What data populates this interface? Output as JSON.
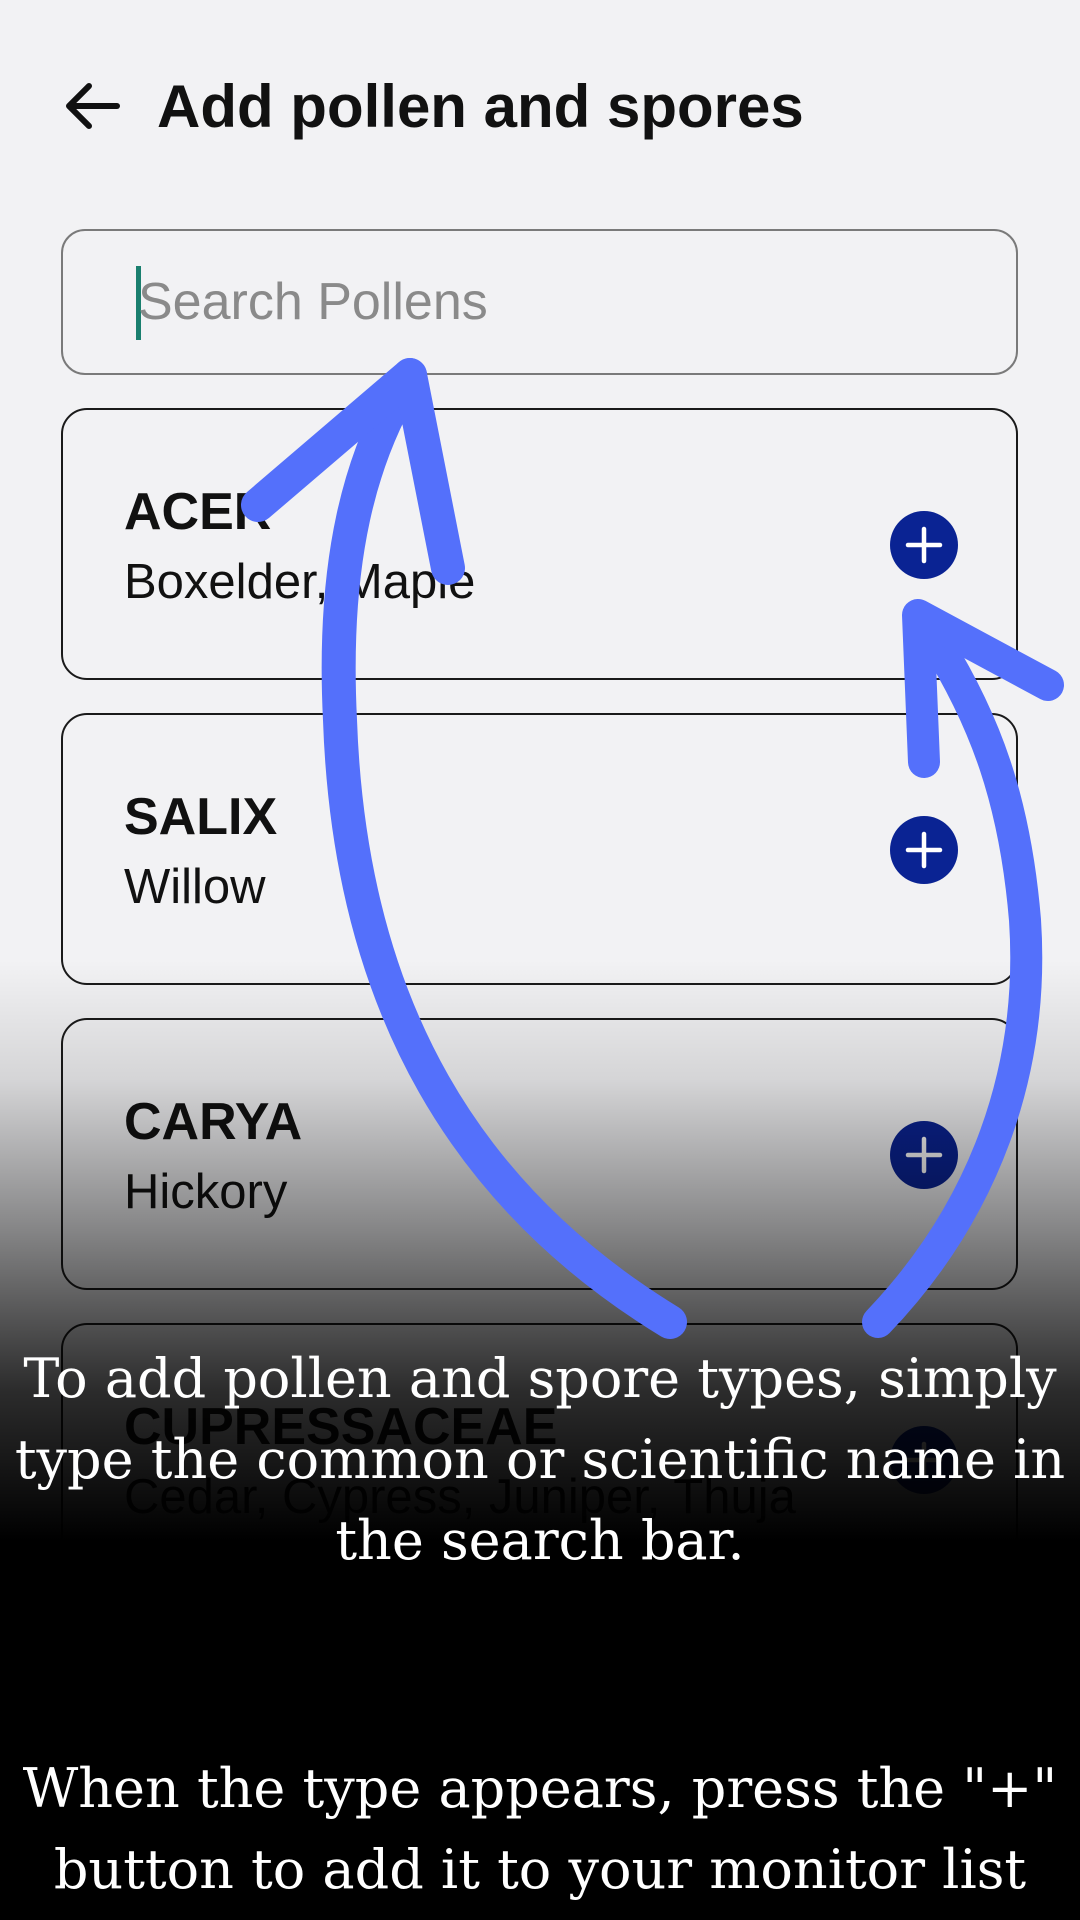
{
  "header": {
    "title": "Add pollen and spores",
    "back_icon": "arrow-left-icon"
  },
  "search": {
    "placeholder": "Search Pollens",
    "value": ""
  },
  "pollens": [
    {
      "scientific": "ACER",
      "common": "Boxelder, Maple"
    },
    {
      "scientific": "SALIX",
      "common": "Willow"
    },
    {
      "scientific": "CARYA",
      "common": "Hickory"
    },
    {
      "scientific": "CUPRESSACEAE",
      "common": "Cedar, Cypress, Juniper, Thuja"
    }
  ],
  "add_icon": "plus-circle-icon",
  "tutorial": {
    "text_search": "To add pollen and spore types, simply type the common or scientific name in the search bar.",
    "text_add": "When the type appears, press the \"+\" button to add it to your monitor list",
    "arrow_color": "#5470fb"
  },
  "colors": {
    "background": "#f2f2f4",
    "add_button": "#0a2393",
    "cursor": "#1a7f6e"
  }
}
